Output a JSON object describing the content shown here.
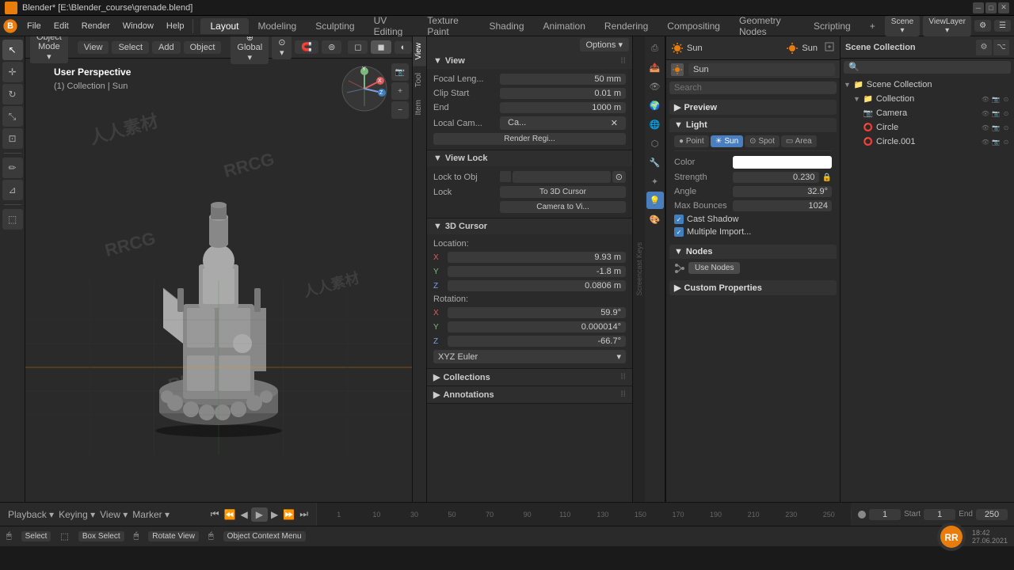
{
  "window": {
    "title": "Blender* [E:\\Blender_course\\grenade.blend]",
    "minimize": "─",
    "maximize": "□",
    "close": "✕"
  },
  "menubar": {
    "logo": "🔵",
    "menus": [
      "File",
      "Edit",
      "Render",
      "Window",
      "Help"
    ],
    "workspaces": [
      "Layout",
      "Modeling",
      "Sculpting",
      "UV Editing",
      "Texture Paint",
      "Shading",
      "Animation",
      "Rendering",
      "Compositing",
      "Geometry Nodes",
      "Scripting"
    ],
    "active_workspace": "Layout",
    "scene": "Scene",
    "view_layer": "ViewLayer",
    "plus_btn": "+"
  },
  "viewport_header": {
    "object_mode": "Object Mode",
    "view": "View",
    "select": "Select",
    "add": "Add",
    "object": "Object",
    "global": "Global",
    "transform_icon": "⊕",
    "pivot_icon": "⊙",
    "overlay_icon": "☉",
    "shading_btns": [
      "●",
      "◐",
      "◻",
      "◼"
    ]
  },
  "viewport_info": {
    "perspective": "User Perspective",
    "collection": "(1) Collection | Sun"
  },
  "view_panel": {
    "title": "View",
    "focal_length_label": "Focal Leng...",
    "focal_length_value": "50 mm",
    "clip_start_label": "Clip Start",
    "clip_start_value": "0.01 m",
    "clip_end_label": "End",
    "clip_end_value": "1000 m",
    "local_cam_label": "Local Cam...",
    "local_cam_value": "Ca...",
    "render_region": "Render Regi...",
    "view_lock_title": "View Lock",
    "lock_to_obj_label": "Lock to Obj",
    "lock_label": "Lock",
    "to_3d_cursor": "To 3D Cursor",
    "camera_to_view": "Camera to Vi...",
    "cursor_3d_title": "3D Cursor",
    "location_label": "Location:",
    "cursor_x_label": "X",
    "cursor_x_value": "9.93 m",
    "cursor_y_label": "Y",
    "cursor_y_value": "-1.8 m",
    "cursor_z_label": "Z",
    "cursor_z_value": "0.0806 m",
    "rotation_label": "Rotation:",
    "rot_x_label": "X",
    "rot_x_value": "59.9°",
    "rot_y_label": "Y",
    "rot_y_value": "0.000014°",
    "rot_z_label": "Z",
    "rot_z_value": "-66.7°",
    "rotation_mode": "XYZ Euler"
  },
  "collections_panel": {
    "title": "Collections"
  },
  "annotations_panel": {
    "title": "Annotations"
  },
  "right_panel": {
    "active_object": "Sun",
    "obj_header_left": "Sun",
    "obj_header_right": "Sun",
    "search_placeholder": "Search",
    "preview_title": "Preview",
    "light_title": "Light",
    "light_types": [
      "Point",
      "Sun",
      "Spot",
      "Area"
    ],
    "active_light_type": "Sun",
    "color_label": "Color",
    "color_value": "#ffffff",
    "strength_label": "Strength",
    "strength_value": "0.230",
    "angle_label": "Angle",
    "angle_value": "32.9°",
    "max_bounces_label": "Max Bounces",
    "max_bounces_value": "1024",
    "cast_shadow_label": "Cast Shadow",
    "cast_shadow_checked": true,
    "multiple_importance_label": "Multiple Import...",
    "multiple_importance_checked": true,
    "nodes_title": "Nodes",
    "use_nodes_btn": "Use Nodes",
    "custom_props_title": "Custom Properties"
  },
  "outliner": {
    "title": "Scene Collection",
    "items": [
      {
        "name": "Scene Collection",
        "indent": 0,
        "icon": "📁",
        "active": false
      },
      {
        "name": "Collection",
        "indent": 1,
        "icon": "📁",
        "active": false
      },
      {
        "name": "Camera",
        "indent": 2,
        "icon": "📷",
        "active": false
      },
      {
        "name": "Circle",
        "indent": 2,
        "icon": "⭕",
        "active": false
      },
      {
        "name": "Circle.001",
        "indent": 2,
        "icon": "⭕",
        "active": false
      }
    ]
  },
  "timeline": {
    "playback_label": "Playback",
    "keying_label": "Keying",
    "view_label": "View",
    "marker_label": "Marker",
    "current_frame": "1",
    "start_label": "Start",
    "start_value": "1",
    "end_label": "End",
    "end_value": "250",
    "frame_markers": [
      "1",
      "10",
      "30",
      "50",
      "70",
      "90",
      "110",
      "130",
      "150",
      "170",
      "190",
      "210",
      "230",
      "250"
    ]
  },
  "status_bar": {
    "select_key": "Select",
    "box_select_key": "Box Select",
    "rotate_view": "Rotate View",
    "obj_context": "Object Context Menu",
    "select_icon": "🖱",
    "box_icon": "⬚",
    "rotate_icon": "🖱",
    "obj_icon": "🖱"
  },
  "left_tools": [
    {
      "icon": "↖",
      "name": "cursor-tool",
      "active": true
    },
    {
      "icon": "⊕",
      "name": "move-tool",
      "active": false
    },
    {
      "icon": "↻",
      "name": "rotate-tool",
      "active": false
    },
    {
      "icon": "⊞",
      "name": "scale-tool",
      "active": false
    },
    {
      "icon": "⊿",
      "name": "transform-tool",
      "active": false
    },
    {
      "icon": "✏",
      "name": "annotate-tool",
      "active": false
    },
    {
      "icon": "✂",
      "name": "measure-tool",
      "active": false
    }
  ],
  "prop_tabs": [
    {
      "icon": "🔧",
      "name": "render-tab",
      "active": false
    },
    {
      "icon": "📤",
      "name": "output-tab",
      "active": false
    },
    {
      "icon": "👁",
      "name": "view-tab",
      "active": false
    },
    {
      "icon": "🌍",
      "name": "scene-tab",
      "active": false
    },
    {
      "icon": "🌐",
      "name": "world-tab",
      "active": false
    },
    {
      "icon": "🔲",
      "name": "object-tab",
      "active": false
    },
    {
      "icon": "✦",
      "name": "modifier-tab",
      "active": false
    },
    {
      "icon": "📐",
      "name": "particles-tab",
      "active": false
    },
    {
      "icon": "💡",
      "name": "data-tab",
      "active": true
    },
    {
      "icon": "🎨",
      "name": "material-tab",
      "active": false
    }
  ]
}
